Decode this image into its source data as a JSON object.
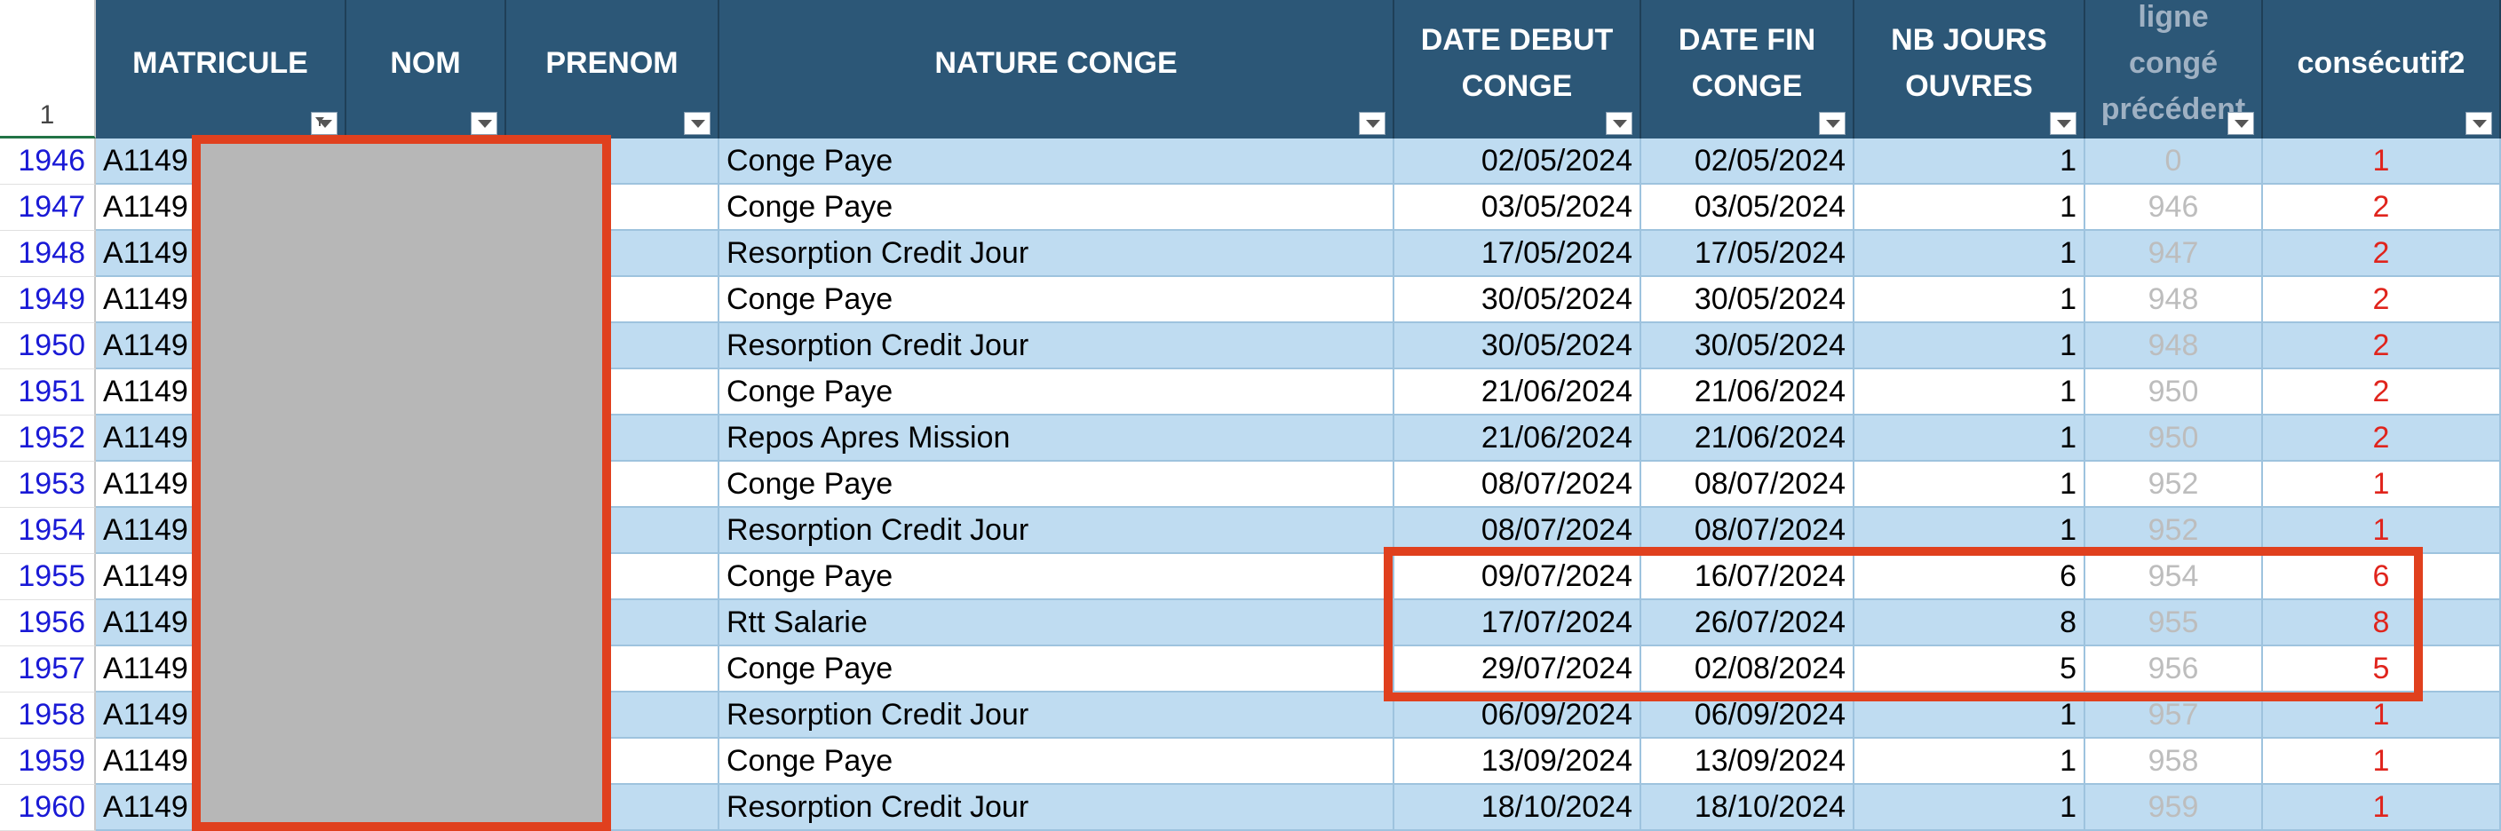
{
  "header": {
    "row_number": "1",
    "columns": {
      "matricule": "MATRICULE",
      "nom": "NOM",
      "prenom": "PRENOM",
      "nature": "NATURE CONGE",
      "date_debut": "DATE DEBUT\nCONGE",
      "date_fin": "DATE FIN\nCONGE",
      "nb_jours": "NB JOURS\nOUVRES",
      "ligne_prec": "ligne\ncongé\nprécédent",
      "consecutif": "consécutif2"
    }
  },
  "rows": [
    {
      "rn": "1946",
      "matricule": "A1149",
      "nature": "Conge Paye",
      "debut": "02/05/2024",
      "fin": "02/05/2024",
      "nb": "1",
      "prec": "0",
      "consec": "1"
    },
    {
      "rn": "1947",
      "matricule": "A1149",
      "nature": "Conge Paye",
      "debut": "03/05/2024",
      "fin": "03/05/2024",
      "nb": "1",
      "prec": "946",
      "consec": "2"
    },
    {
      "rn": "1948",
      "matricule": "A1149",
      "nature": "Resorption Credit Jour",
      "debut": "17/05/2024",
      "fin": "17/05/2024",
      "nb": "1",
      "prec": "947",
      "consec": "2"
    },
    {
      "rn": "1949",
      "matricule": "A1149",
      "nature": "Conge Paye",
      "debut": "30/05/2024",
      "fin": "30/05/2024",
      "nb": "1",
      "prec": "948",
      "consec": "2"
    },
    {
      "rn": "1950",
      "matricule": "A1149",
      "nature": "Resorption Credit Jour",
      "debut": "30/05/2024",
      "fin": "30/05/2024",
      "nb": "1",
      "prec": "948",
      "consec": "2"
    },
    {
      "rn": "1951",
      "matricule": "A1149",
      "nature": "Conge Paye",
      "debut": "21/06/2024",
      "fin": "21/06/2024",
      "nb": "1",
      "prec": "950",
      "consec": "2"
    },
    {
      "rn": "1952",
      "matricule": "A1149",
      "nature": "Repos Apres Mission",
      "debut": "21/06/2024",
      "fin": "21/06/2024",
      "nb": "1",
      "prec": "950",
      "consec": "2"
    },
    {
      "rn": "1953",
      "matricule": "A1149",
      "nature": "Conge Paye",
      "debut": "08/07/2024",
      "fin": "08/07/2024",
      "nb": "1",
      "prec": "952",
      "consec": "1"
    },
    {
      "rn": "1954",
      "matricule": "A1149",
      "nature": "Resorption Credit Jour",
      "debut": "08/07/2024",
      "fin": "08/07/2024",
      "nb": "1",
      "prec": "952",
      "consec": "1"
    },
    {
      "rn": "1955",
      "matricule": "A1149",
      "nature": "Conge Paye",
      "debut": "09/07/2024",
      "fin": "16/07/2024",
      "nb": "6",
      "prec": "954",
      "consec": "6"
    },
    {
      "rn": "1956",
      "matricule": "A1149",
      "nature": "Rtt Salarie",
      "debut": "17/07/2024",
      "fin": "26/07/2024",
      "nb": "8",
      "prec": "955",
      "consec": "8"
    },
    {
      "rn": "1957",
      "matricule": "A1149",
      "nature": "Conge Paye",
      "debut": "29/07/2024",
      "fin": "02/08/2024",
      "nb": "5",
      "prec": "956",
      "consec": "5"
    },
    {
      "rn": "1958",
      "matricule": "A1149",
      "nature": "Resorption Credit Jour",
      "debut": "06/09/2024",
      "fin": "06/09/2024",
      "nb": "1",
      "prec": "957",
      "consec": "1"
    },
    {
      "rn": "1959",
      "matricule": "A1149",
      "nature": "Conge Paye",
      "debut": "13/09/2024",
      "fin": "13/09/2024",
      "nb": "1",
      "prec": "958",
      "consec": "1"
    },
    {
      "rn": "1960",
      "matricule": "A1149",
      "nature": "Resorption Credit Jour",
      "debut": "18/10/2024",
      "fin": "18/10/2024",
      "nb": "1",
      "prec": "959",
      "consec": "1"
    }
  ],
  "colors": {
    "header_bg": "#2c5777",
    "row_band": "#bfdcf1",
    "highlight": "#e0401e",
    "redaction": "#b7b7b7",
    "consecutif_text": "#e0241c"
  }
}
